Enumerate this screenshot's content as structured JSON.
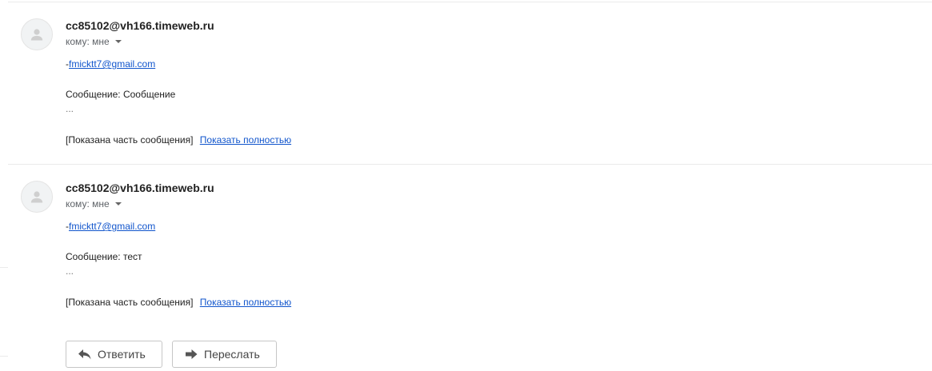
{
  "messages": [
    {
      "sender": "cc85102@vh166.timeweb.ru",
      "recipient": "кому: мне",
      "from_prefix": "-",
      "from_email": "fmicktt7@gmail.com",
      "body": "Сообщение: Сообщение",
      "ellipsis": "...",
      "clipped_notice": "[Показана часть сообщения]",
      "show_full_label": "Показать полностью"
    },
    {
      "sender": "cc85102@vh166.timeweb.ru",
      "recipient": "кому: мне",
      "from_prefix": "-",
      "from_email": "fmicktt7@gmail.com",
      "body": "Сообщение: тест",
      "ellipsis": "...",
      "clipped_notice": "[Показана часть сообщения]",
      "show_full_label": "Показать полностью"
    }
  ],
  "actions": {
    "reply_label": "Ответить",
    "forward_label": "Переслать",
    "reply_icon": "reply-arrow-icon",
    "forward_icon": "forward-arrow-icon"
  },
  "colors": {
    "link": "#1155cc",
    "divider": "#ebebeb",
    "avatar_bg": "#f1f3f4"
  }
}
